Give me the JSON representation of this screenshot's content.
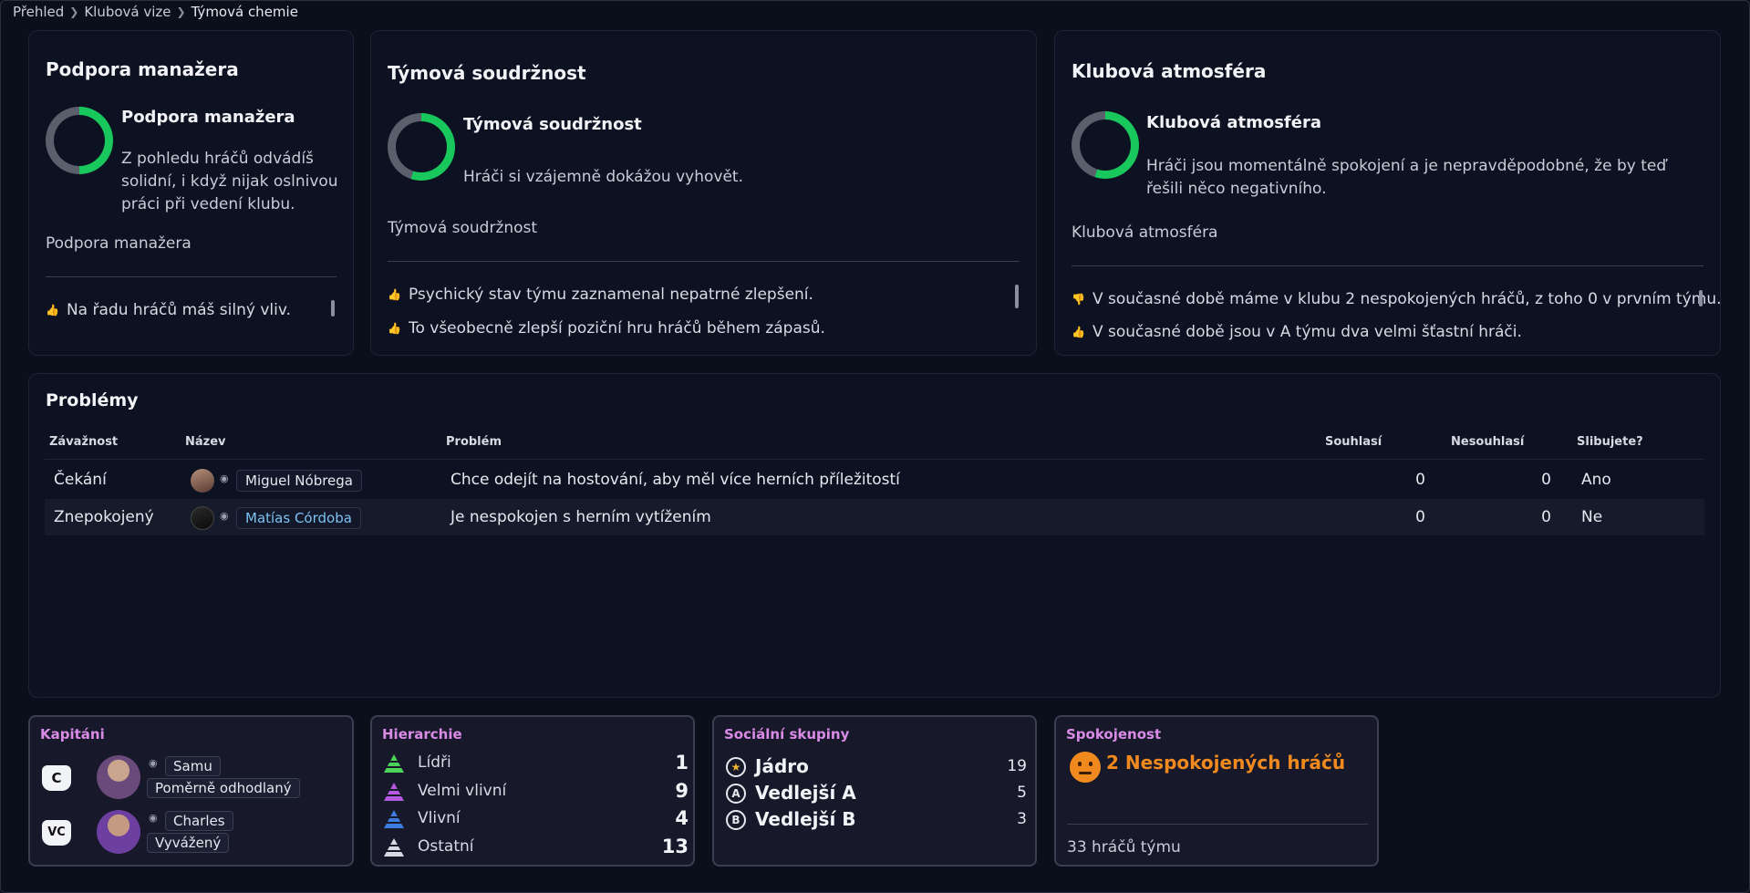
{
  "breadcrumb": {
    "items": [
      "Přehled",
      "Klubová vize",
      "Týmová chemie"
    ]
  },
  "status_cards": [
    {
      "heading": "Podpora manažera",
      "status_title": "Podpora manažera",
      "status_desc": "Z pohledu hráčů odvádíš solidní, i když nijak oslnivou práci při vedení klubu.",
      "subtitle": "Podpora manažera",
      "feedback": [
        "Na řadu hráčů máš silný vliv."
      ],
      "level": 0.5
    },
    {
      "heading": "Týmová soudržnost",
      "status_title": "Týmová soudržnost",
      "status_desc": "Hráči si vzájemně dokážou vyhovět.",
      "subtitle": "Týmová soudržnost",
      "feedback": [
        "Psychický stav týmu zaznamenal nepatrné zlepšení.",
        "To všeobecně zlepší poziční hru hráčů během zápasů."
      ],
      "level": 0.55
    },
    {
      "heading": "Klubová atmosféra",
      "status_title": "Klubová atmosféra",
      "status_desc": "Hráči jsou momentálně spokojení a je nepravděpodobné, že by teď řešili něco negativního.",
      "subtitle": "Klubová atmosféra",
      "feedback": [
        "V současné době máme v klubu 2 nespokojených hráčů, z toho 0 v prvním týmu.",
        "V současné době jsou v A týmu dva velmi šťastní hráči."
      ],
      "level": 0.55
    }
  ],
  "problems": {
    "title": "Problémy",
    "columns": [
      "Závažnost",
      "Název",
      "Problém",
      "Souhlasí",
      "Nesouhlasí",
      "Slibujete?"
    ],
    "rows": [
      {
        "severity": "Čekání",
        "name": "Miguel Nóbrega",
        "problem": "Chce odejít na hostování, aby měl více herních příležitostí",
        "agree": "0",
        "disagree": "0",
        "promise": "Ano"
      },
      {
        "severity": "Znepokojený",
        "name": "Matías Córdoba",
        "problem": "Je nespokojen s herním vytížením",
        "agree": "0",
        "disagree": "0",
        "promise": "Ne"
      }
    ]
  },
  "captains": {
    "title": "Kapitáni",
    "items": [
      {
        "badge": "C",
        "name": "Samu",
        "trait": "Poměrně odhodlaný"
      },
      {
        "badge": "VC",
        "name": "Charles",
        "trait": "Vyvážený"
      }
    ]
  },
  "hierarchy": {
    "title": "Hierarchie",
    "items": [
      {
        "label": "Lídři",
        "value": "1",
        "color": "#4cd45a"
      },
      {
        "label": "Velmi vlivní",
        "value": "9",
        "color": "#b45ae0"
      },
      {
        "label": "Vlivní",
        "value": "4",
        "color": "#3d7be0"
      },
      {
        "label": "Ostatní",
        "value": "13",
        "color": "#d7dae3"
      }
    ]
  },
  "social_groups": {
    "title": "Sociální skupiny",
    "items": [
      {
        "icon": "★",
        "label": "Jádro",
        "value": "19"
      },
      {
        "icon": "A",
        "label": "Vedlejší A",
        "value": "5"
      },
      {
        "icon": "B",
        "label": "Vedlejší B",
        "value": "3"
      }
    ]
  },
  "satisfaction": {
    "title": "Spokojenost",
    "headline": "2 Nespokojených hráčů",
    "footer": "33 hráčů týmu",
    "accent": "#f08a1e"
  }
}
